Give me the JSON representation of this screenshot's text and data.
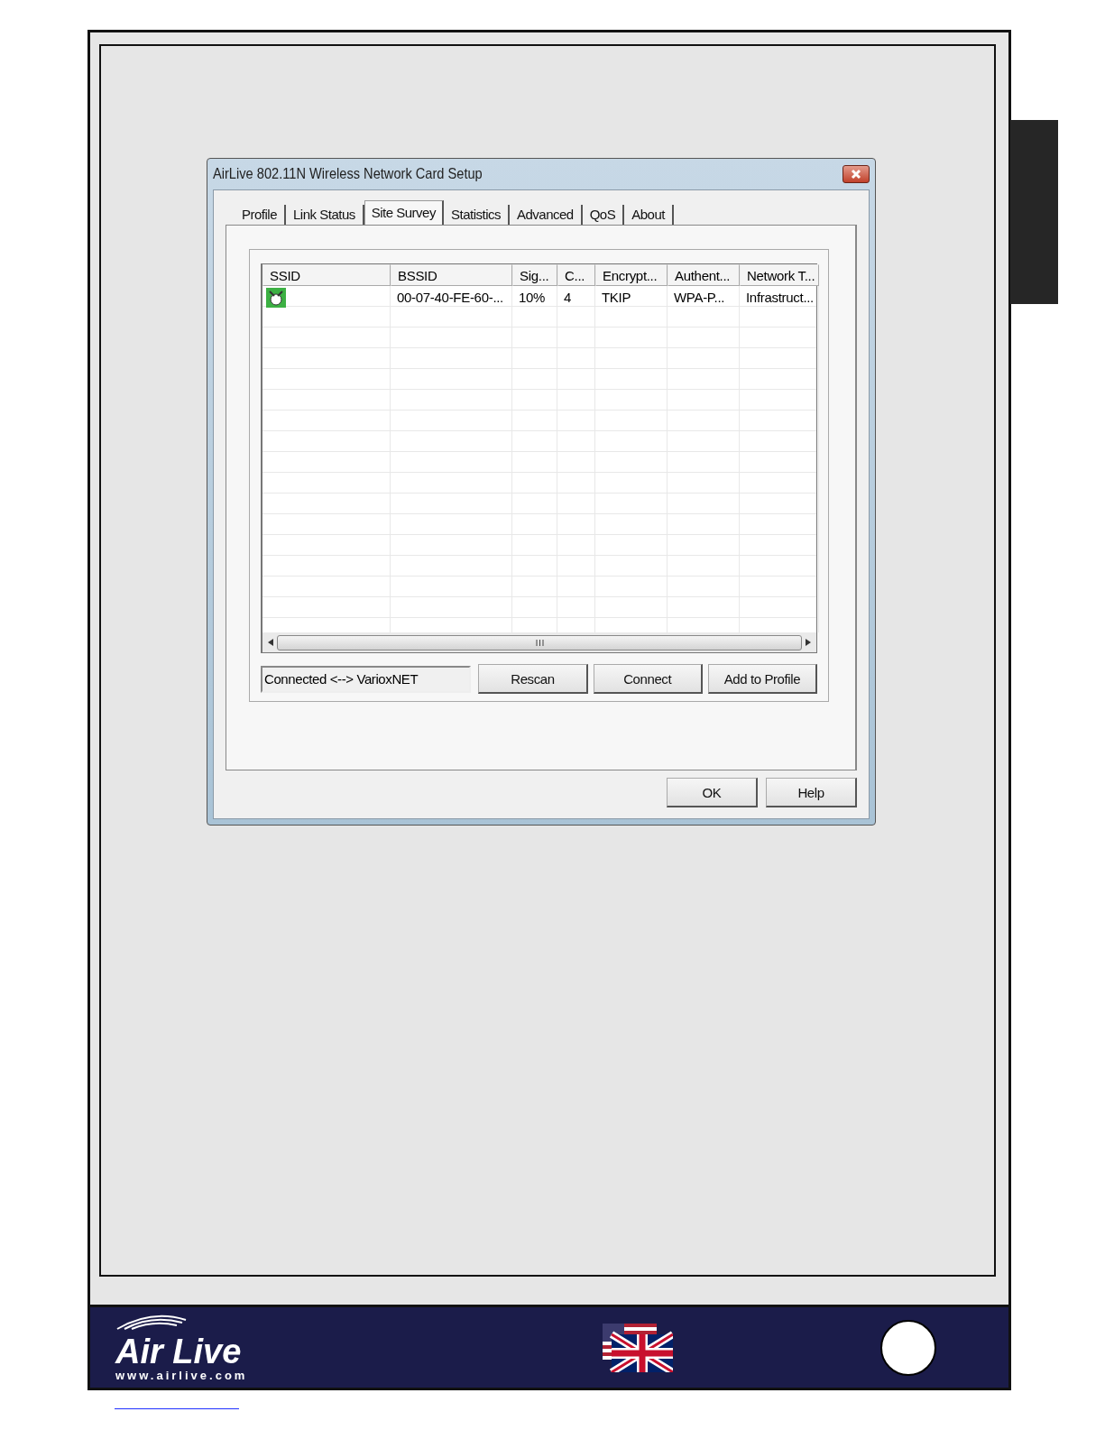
{
  "window": {
    "title": "AirLive 802.11N Wireless Network Card Setup"
  },
  "tabs": [
    {
      "label": "Profile",
      "selected": false
    },
    {
      "label": "Link Status",
      "selected": false
    },
    {
      "label": "Site Survey",
      "selected": true
    },
    {
      "label": "Statistics",
      "selected": false
    },
    {
      "label": "Advanced",
      "selected": false
    },
    {
      "label": "QoS",
      "selected": false
    },
    {
      "label": "About",
      "selected": false
    }
  ],
  "table": {
    "columns": [
      "SSID",
      "BSSID",
      "Sig...",
      "C...",
      "Encrypt...",
      "Authent...",
      "Network T..."
    ],
    "rows": [
      {
        "cells": [
          "",
          "00-07-40-FE-60-...",
          "10%",
          "4",
          "TKIP",
          "WPA-P...",
          "Infrastruct..."
        ]
      }
    ]
  },
  "status_field": {
    "value": "Connected <--> VarioxNET"
  },
  "action_buttons": [
    "Rescan",
    "Connect",
    "Add to Profile"
  ],
  "dialog_buttons": [
    "OK",
    "Help"
  ],
  "footer": {
    "logo": "Air Live",
    "website": "www.airlive.com"
  }
}
